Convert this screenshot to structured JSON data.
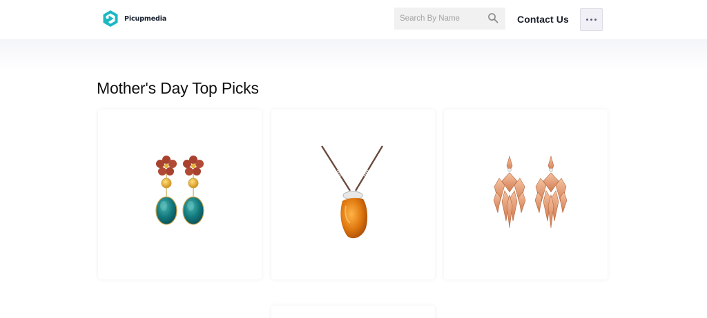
{
  "header": {
    "logo_text": "Picupmedia",
    "search": {
      "placeholder": "Search By Name",
      "value": ""
    },
    "contact_label": "Contact Us",
    "more_icon": "more-horizontal-icon"
  },
  "main": {
    "section_title": "Mother's Day Top Picks",
    "products": [
      {
        "image": "flower-drop-earrings"
      },
      {
        "image": "amber-pendant-necklace"
      },
      {
        "image": "crystal-chandelier-earrings"
      },
      {
        "image": "partially-visible-product"
      }
    ]
  },
  "colors": {
    "brand_teal": "#1bb8c3",
    "header_bg": "#ffffff",
    "search_bg": "#f1f1f1",
    "more_button_bg": "#f0f0f6"
  }
}
